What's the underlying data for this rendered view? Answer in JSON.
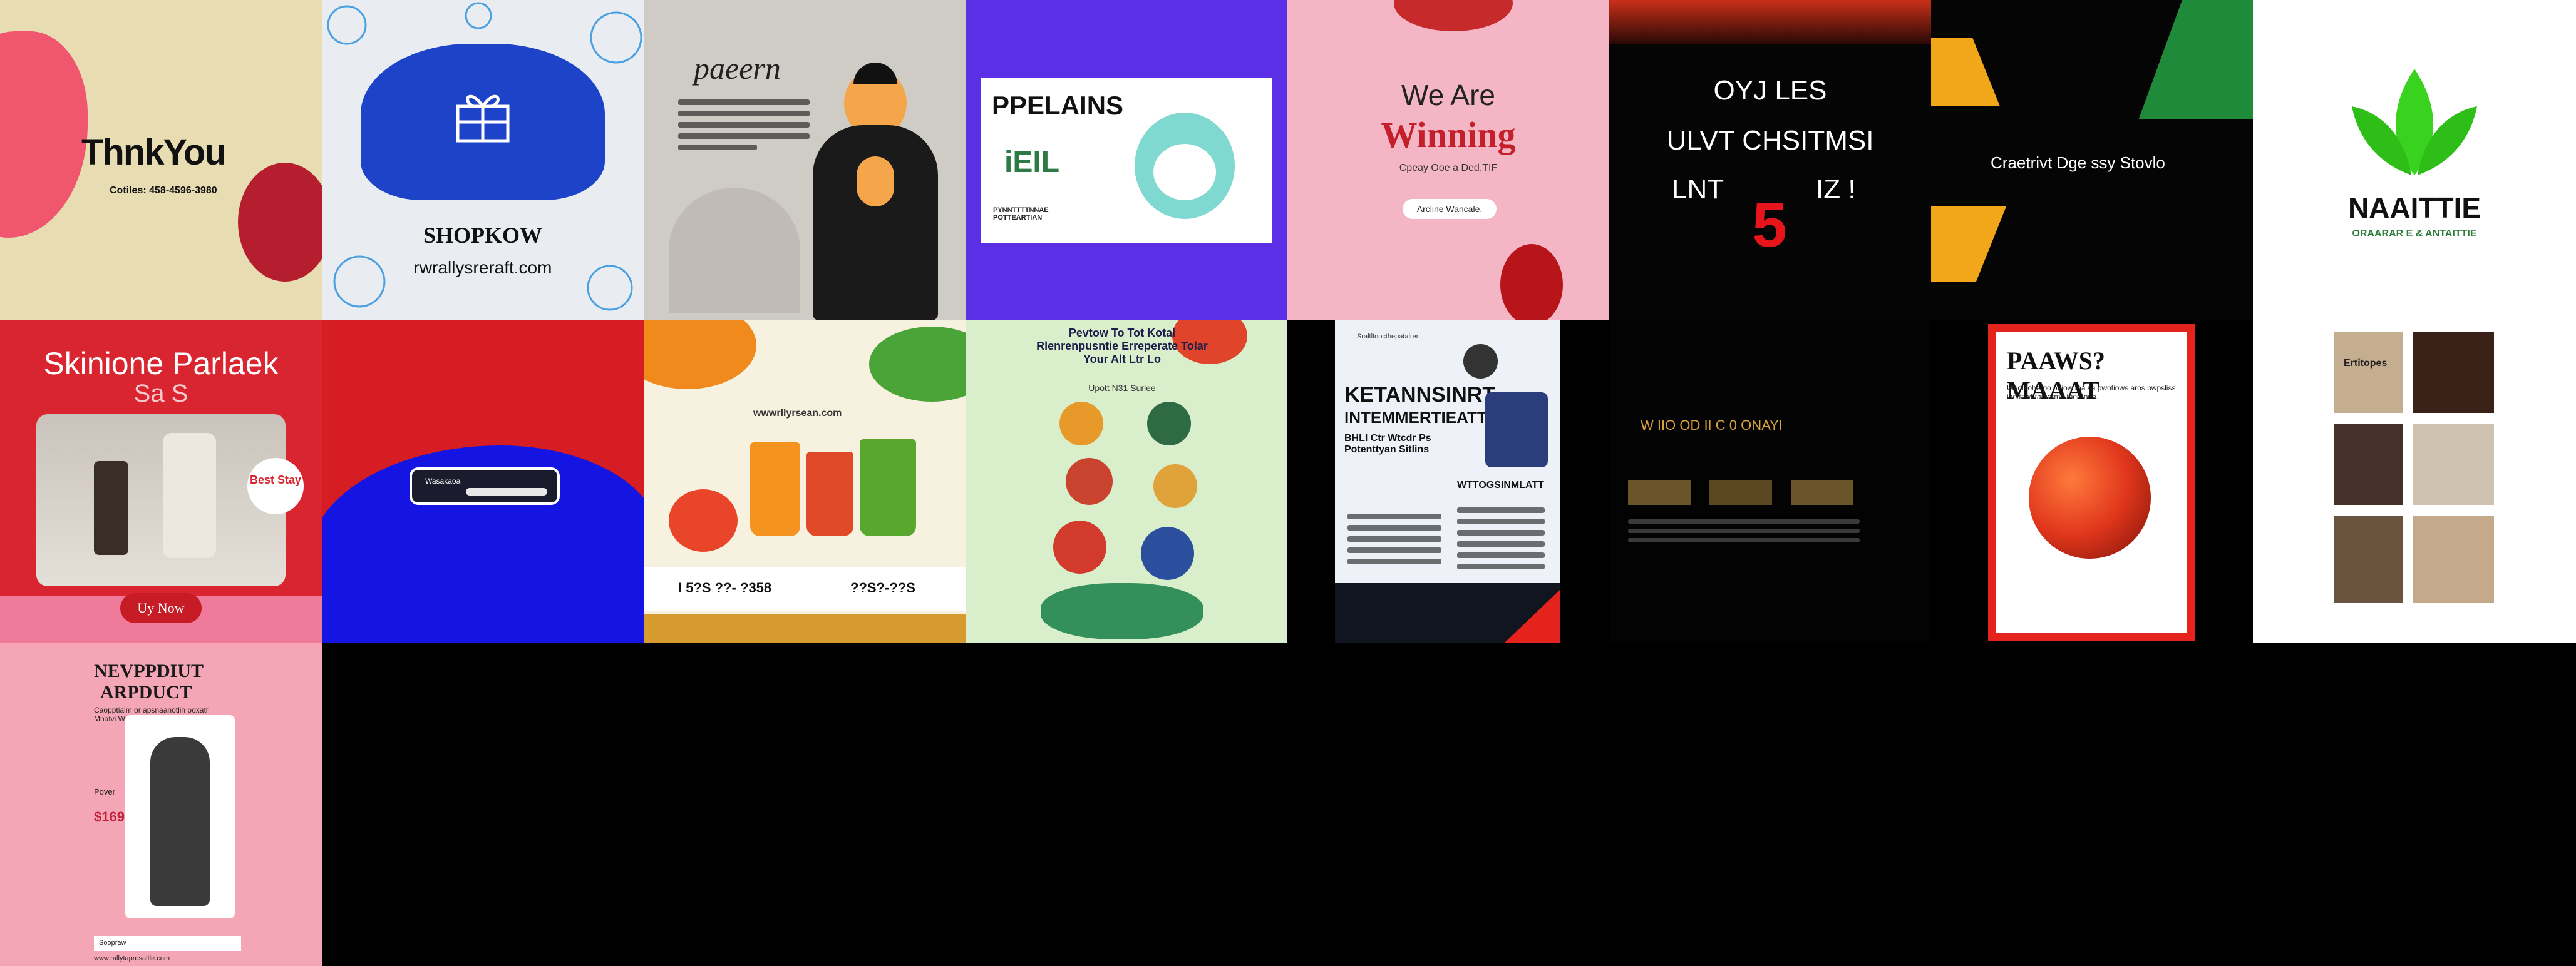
{
  "gallery": {
    "tiles": [
      {
        "id": "t1",
        "title": "ThnkYou",
        "subtitle": "Cotiles: 458-4596-3980"
      },
      {
        "id": "t2",
        "title": "SHOPKOW",
        "subtitle": "rwrallysreraft.com",
        "icon": "gift-box-icon"
      },
      {
        "id": "t3",
        "title": "paeern"
      },
      {
        "id": "t4",
        "title": "PPELAINS",
        "subtitle": "iEIL",
        "small": "PYNNTTTTNNAE POTTEARTIAN",
        "icon": "cute-character-icon"
      },
      {
        "id": "t5",
        "line1": "We Are",
        "line2": "Winning",
        "subtitle": "Cpeay Ooe a Ded.TIF",
        "button": "Arcline Wancale."
      },
      {
        "id": "t6",
        "line1": "OYJ LES",
        "line2": "ULVT CHSITMSI",
        "line3": "LNT",
        "line3b": "IZ !",
        "badge": "5"
      },
      {
        "id": "t7",
        "title": "Craetrivt Dge ssy Stovlo"
      },
      {
        "id": "t8",
        "title": "NAAITTIE",
        "subtitle": "ORAARAR E & ANTAITTIE",
        "icon": "leaf-icon"
      },
      {
        "id": "t9",
        "line1": "Skinione Parlaek",
        "line2": "Sa S",
        "badge": "Best Stay",
        "button": "Uy Now"
      },
      {
        "id": "t10",
        "card": "Wasakaoa"
      },
      {
        "id": "t11",
        "url": "wwwrllyrsean.com",
        "phone1": "I 5?S ??- ?358",
        "phone2": "??S?-??S"
      },
      {
        "id": "t12",
        "title": "Pevtow To Tot Kotal Rlenrenpusntie Erreperate Tolar Your Alt Ltr Lo",
        "subtitle": "Upott N31 Surlee"
      },
      {
        "id": "t13",
        "header": "Sraltltoocthepatalrer",
        "title": "KETANNSINRT",
        "title2": "INTEMMERTIEATT",
        "subtitle": "BHLI Ctr Wtcdr Ps Potenttyan Sitlins",
        "section": "WTTOGSINMLATT"
      },
      {
        "id": "t14",
        "title": "W IIO OD II C 0 ONAYI"
      },
      {
        "id": "t15",
        "title": "PAAWS? MAAAT",
        "subtitle": "Ulvonloherpo paiow tha sa pwotiows aros pwpsliss iee tawt tamarme ther tnne."
      },
      {
        "id": "t16",
        "title": "Ertitopes"
      },
      {
        "id": "t17",
        "title": "NEVPPDIUT",
        "title2": "ARPDUCT",
        "subtitle": "Caopptialm or apsnaanotlin poxatr Mnatvi Warnes",
        "label": "Pover",
        "price": "$169",
        "footer": "Soopraw",
        "url": "www.rallytaprosaltle.com"
      }
    ]
  },
  "colors": {
    "t1": "#e8dcb2",
    "t2": "#1d43c8",
    "t4": "#5a2fe6",
    "t5": "#f4b6c4",
    "t9": "#d9252f",
    "t11": "#f7f2e0",
    "t12": "#d9efcc",
    "t15": "#e3231c",
    "t17": "#f4a6b6"
  }
}
